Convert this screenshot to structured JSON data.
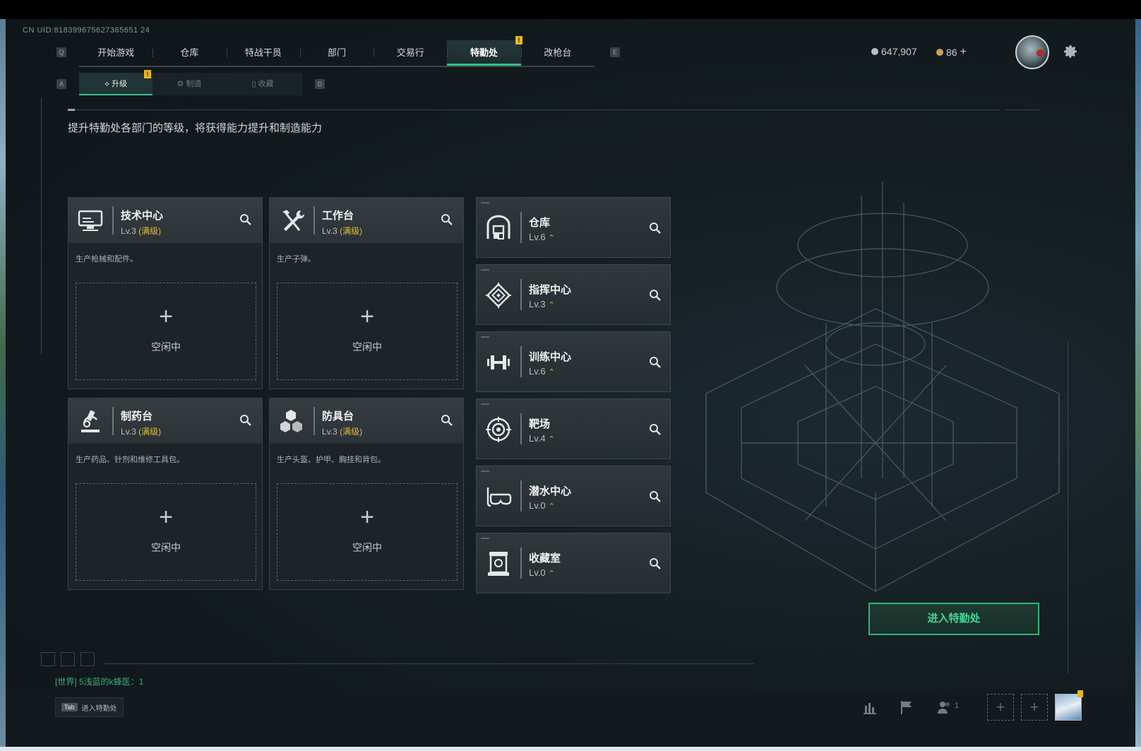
{
  "uid": "CN UID:818399675627365651 24",
  "keyhints": {
    "q": "Q",
    "e": "E",
    "a": "A",
    "d": "D"
  },
  "main_nav": [
    {
      "label": "开始游戏"
    },
    {
      "label": "仓库"
    },
    {
      "label": "特战干员"
    },
    {
      "label": "部门"
    },
    {
      "label": "交易行"
    },
    {
      "label": "特勤处",
      "active": true,
      "badge": "!"
    },
    {
      "label": "改枪台"
    }
  ],
  "currency": {
    "coins": "647,907",
    "tickets": "86",
    "plus": "+"
  },
  "sub_nav": [
    {
      "label": "升级",
      "active": true,
      "badge": "!"
    },
    {
      "label": "制造"
    },
    {
      "label": "收藏"
    }
  ],
  "description": "提升特勤处各部门的等级，将获得能力提升和制造能力",
  "workshops": [
    {
      "name": "技术中心",
      "level": "Lv.3",
      "status": "(满级)",
      "text": "生产枪械和配件。",
      "slot_plus": "+",
      "slot_label": "空闲中",
      "icon": "computer-icon"
    },
    {
      "name": "工作台",
      "level": "Lv.3",
      "status": "(满级)",
      "text": "生产子弹。",
      "slot_plus": "+",
      "slot_label": "空闲中",
      "icon": "tools-icon"
    },
    {
      "name": "制药台",
      "level": "Lv.3",
      "status": "(满级)",
      "text": "生产药品、针剂和维修工具包。",
      "slot_plus": "+",
      "slot_label": "空闲中",
      "icon": "microscope-icon"
    },
    {
      "name": "防具台",
      "level": "Lv.3",
      "status": "(满级)",
      "text": "生产头盔、护甲、胸挂和背包。",
      "slot_plus": "+",
      "slot_label": "空闲中",
      "icon": "armor-boxes-icon"
    }
  ],
  "rooms": [
    {
      "name": "仓库",
      "level": "Lv.6",
      "up": "⌃",
      "icon": "warehouse-icon"
    },
    {
      "name": "指挥中心",
      "level": "Lv.3",
      "up": "⌃",
      "icon": "command-icon"
    },
    {
      "name": "训练中心",
      "level": "Lv.6",
      "up": "⌃",
      "icon": "dumbbell-icon"
    },
    {
      "name": "靶场",
      "level": "Lv.4",
      "up": "⌃",
      "icon": "target-icon"
    },
    {
      "name": "潜水中心",
      "level": "Lv.0",
      "up": "⌃",
      "icon": "diving-mask-icon"
    },
    {
      "name": "收藏室",
      "level": "Lv.0",
      "up": "⌃",
      "icon": "collection-icon"
    }
  ],
  "enter_button": "进入特勤处",
  "world_chat": "[世界] 5浅蓝的k蜂医：1",
  "bottom": {
    "tab_key": "Tab",
    "tab_label": "进入特勤处",
    "friends_count": "1",
    "slot_plus": "+"
  },
  "colors": {
    "accent": "#35c28a",
    "maxed": "#e5b83a",
    "badge": "#e7b622"
  }
}
